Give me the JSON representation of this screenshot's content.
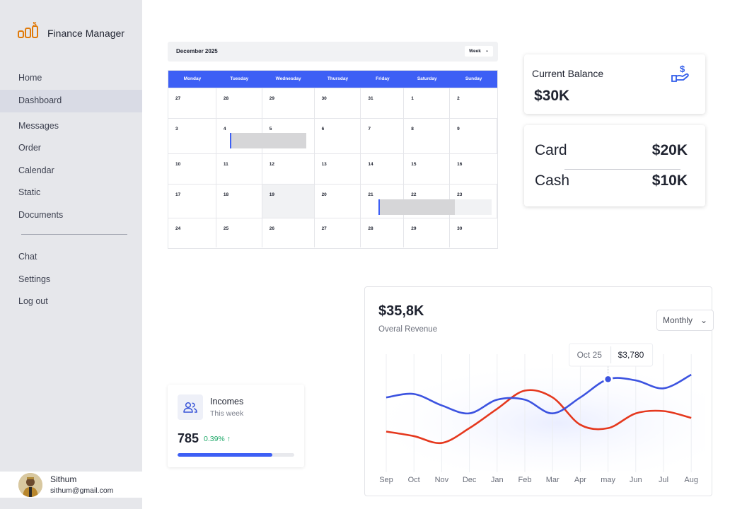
{
  "app": {
    "title": "Finance Manager"
  },
  "sidebar": {
    "items": [
      {
        "label": "Home",
        "id": "home"
      },
      {
        "label": "Dashboard",
        "id": "dashboard",
        "active": true
      },
      {
        "label": "Messages",
        "id": "messages"
      },
      {
        "label": "Order",
        "id": "order"
      },
      {
        "label": "Calendar",
        "id": "calendar"
      },
      {
        "label": "Static",
        "id": "static"
      },
      {
        "label": "Documents",
        "id": "documents"
      }
    ],
    "secondary": [
      {
        "label": "Chat",
        "id": "chat"
      },
      {
        "label": "Settings",
        "id": "settings"
      },
      {
        "label": "Log out",
        "id": "logout"
      }
    ]
  },
  "user": {
    "name": "Sithum",
    "email": "sithum@gmail.com"
  },
  "calendar": {
    "title": "December 2025",
    "view": "Week",
    "weekdays": [
      "Monday",
      "Tuesday",
      "Wednesday",
      "Thursday",
      "Friday",
      "Saturday",
      "Sunday"
    ],
    "weeks": [
      [
        "27",
        "28",
        "29",
        "30",
        "31",
        "1",
        "2"
      ],
      [
        "3",
        "4",
        "5",
        "6",
        "7",
        "8",
        "9"
      ],
      [
        "10",
        "11",
        "12",
        "13",
        "14",
        "15",
        "16"
      ],
      [
        "17",
        "18",
        "19",
        "20",
        "21",
        "22",
        "23"
      ],
      [
        "24",
        "25",
        "26",
        "27",
        "28",
        "29",
        "30"
      ]
    ],
    "highlighted_day": "19"
  },
  "balance": {
    "label": "Current Balance",
    "value": "$30K"
  },
  "split": {
    "card_label": "Card",
    "card_value": "$20K",
    "cash_label": "Cash",
    "cash_value": "$10K"
  },
  "incomes": {
    "title": "Incomes",
    "period": "This week",
    "value": "785",
    "change": "0.39% ↑",
    "progress_fraction": 0.81
  },
  "revenue": {
    "value": "$35,8K",
    "label": "Overal Revenue",
    "period": "Monthly",
    "tooltip_date": "Oct 25",
    "tooltip_value": "$3,780"
  },
  "colors": {
    "accent": "#3d5ff5",
    "series_blue": "#3c53e0",
    "series_red": "#e5381e",
    "positive": "#1ea868"
  },
  "chart_data": {
    "type": "line",
    "categories": [
      "Sep",
      "Oct",
      "Nov",
      "Dec",
      "Jan",
      "Feb",
      "Mar",
      "Apr",
      "may",
      "Jun",
      "Jul",
      "Aug"
    ],
    "series": [
      {
        "values": [
          62,
          65,
          55,
          48,
          60,
          60,
          48,
          62,
          78,
          77,
          70,
          82
        ]
      },
      {
        "values": [
          32,
          28,
          22,
          35,
          52,
          68,
          62,
          38,
          35,
          48,
          50,
          44
        ]
      }
    ],
    "ylim": [
      0,
      100
    ],
    "grid": true,
    "highlight_point": {
      "series": 0,
      "index": 8
    }
  }
}
